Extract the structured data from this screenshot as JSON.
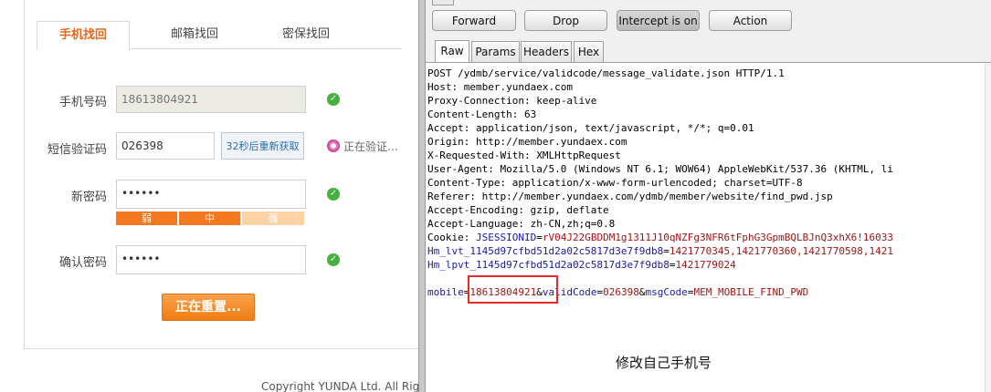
{
  "form": {
    "tabs": [
      "手机找回",
      "邮箱找回",
      "密保找回"
    ],
    "phone_label": "手机号码",
    "phone_value": "18613804921",
    "sms_label": "短信验证码",
    "sms_value": "026398",
    "sms_button": "32秒后重新获取",
    "status_text": "正在验证…",
    "newpwd_label": "新密码",
    "newpwd_value": "••••••",
    "strength": [
      "弱",
      "中",
      "强"
    ],
    "confirm_label": "确认密码",
    "confirm_value": "••••••",
    "submit_label": "正在重置...",
    "copyright": "Copyright YUNDA Ltd. All Rig"
  },
  "burp": {
    "buttons": [
      "Forward",
      "Drop",
      "Intercept is on",
      "Action"
    ],
    "tabs": [
      "Raw",
      "Params",
      "Headers",
      "Hex"
    ],
    "request_lines": [
      "POST /ydmb/service/validcode/message_validate.json HTTP/1.1",
      "Host: member.yundaex.com",
      "Proxy-Connection: keep-alive",
      "Content-Length: 63",
      "Accept: application/json, text/javascript, */*; q=0.01",
      "Origin: http://member.yundaex.com",
      "X-Requested-With: XMLHttpRequest",
      "User-Agent: Mozilla/5.0 (Windows NT 6.1; WOW64) AppleWebKit/537.36 (KHTML, li",
      "Content-Type: application/x-www-form-urlencoded; charset=UTF-8",
      "Referer: http://member.yundaex.com/ydmb/member/website/find_pwd.jsp",
      "Accept-Encoding: gzip, deflate",
      "Accept-Language: zh-CN,zh;q=0.8"
    ],
    "cookie": {
      "prefix": "Cookie: ",
      "name1": "JSESSIONID",
      "val1": "rV04J22GBDDM1g1311J10qNZFg3NFR6tFphG3GpmBQLBJnQ3xhX6!16033",
      "name2": "Hm_lvt_1145d97cfbd51d2a02c5817d3e7f9db8",
      "val2": "1421770345,1421770360,1421770598,1421",
      "name3": "Hm_lpvt_1145d97cfbd51d2a02c5817d3e7f9db8",
      "val3": "1421779024"
    },
    "body": {
      "k1": "mobile",
      "v1": "18613804921",
      "k2": "validCode",
      "v2": "026398",
      "k3": "msgCode",
      "v3": "MEM_MOBILE_FIND_PWD"
    },
    "annotation": "修改自己手机号"
  }
}
